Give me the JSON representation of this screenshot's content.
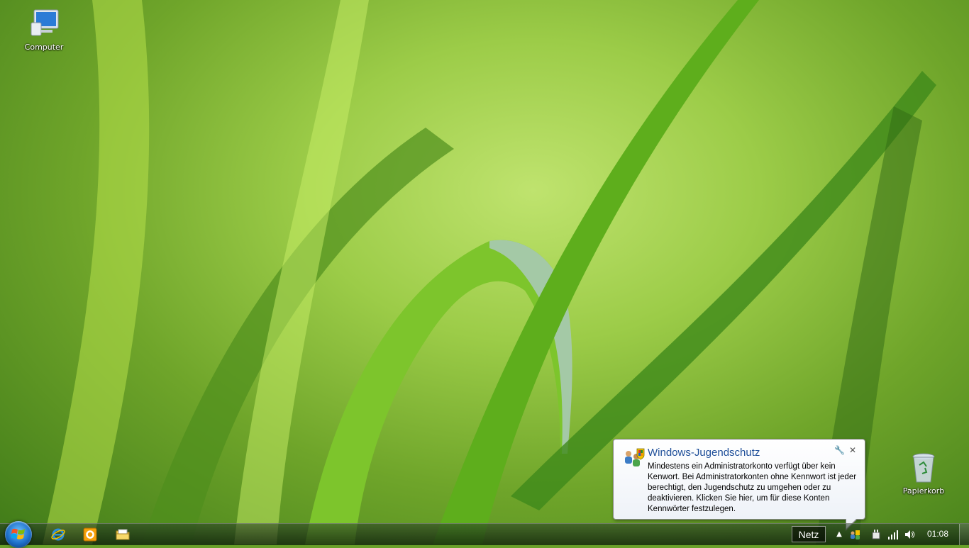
{
  "desktop": {
    "icons": [
      {
        "label": "Computer"
      },
      {
        "label": "Papierkorb"
      }
    ]
  },
  "notification": {
    "title": "Windows-Jugendschutz",
    "body": "Mindestens ein Administratorkonto verfügt über kein Kenwort. Bei Administratorkonten ohne Kennwort ist jeder berechtigt, den Jugendschutz zu umgehen oder zu deaktivieren. Klicken Sie hier, um für diese Konten Kennwörter festzulegen.",
    "options_icon": "wrench-icon",
    "close_icon": "close-icon"
  },
  "taskbar": {
    "pinned": [
      "internet-explorer-icon",
      "outlook-icon",
      "explorer-folder-icon"
    ],
    "tray": {
      "language_button": "Netz",
      "time": "01:08"
    }
  }
}
